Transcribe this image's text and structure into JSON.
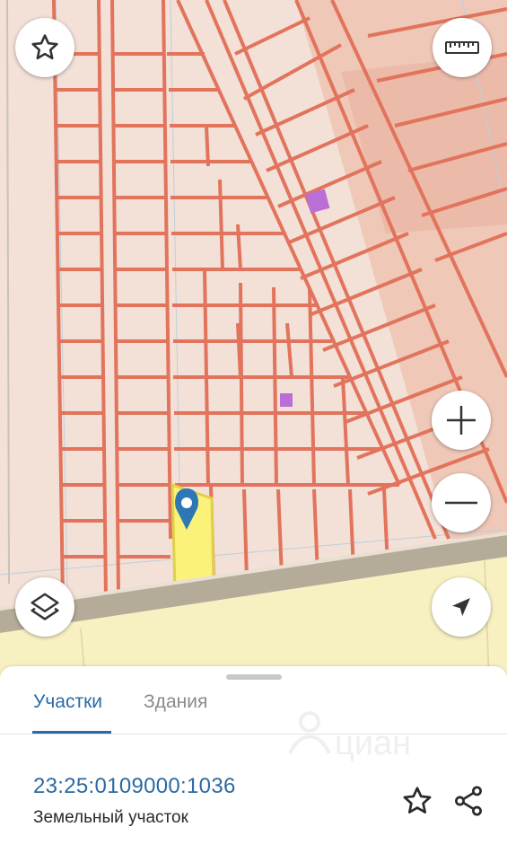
{
  "map": {
    "icons": {
      "favorite": "star-outline-icon",
      "ruler": "ruler-icon",
      "zoom_in": "plus-icon",
      "zoom_out": "minus-icon",
      "layers": "layers-icon",
      "locate": "navigation-arrow-icon",
      "marker": "location-pin-icon"
    },
    "colors": {
      "background": "#f3e0d6",
      "parcel_border": "#e2735c",
      "selected_parcel": "#fbf27a",
      "road": "#b5ab99",
      "field": "#f7f1c2",
      "marker": "#2d77b5",
      "building": "#b96fd6"
    }
  },
  "sheet": {
    "tabs": [
      {
        "label": "Участки",
        "active": true
      },
      {
        "label": "Здания",
        "active": false
      }
    ],
    "parcel": {
      "cadastral_number": "23:25:0109000:1036",
      "type": "Земельный участок"
    },
    "icons": {
      "favorite": "star-outline-icon",
      "share": "share-icon"
    },
    "watermark": "циан"
  }
}
